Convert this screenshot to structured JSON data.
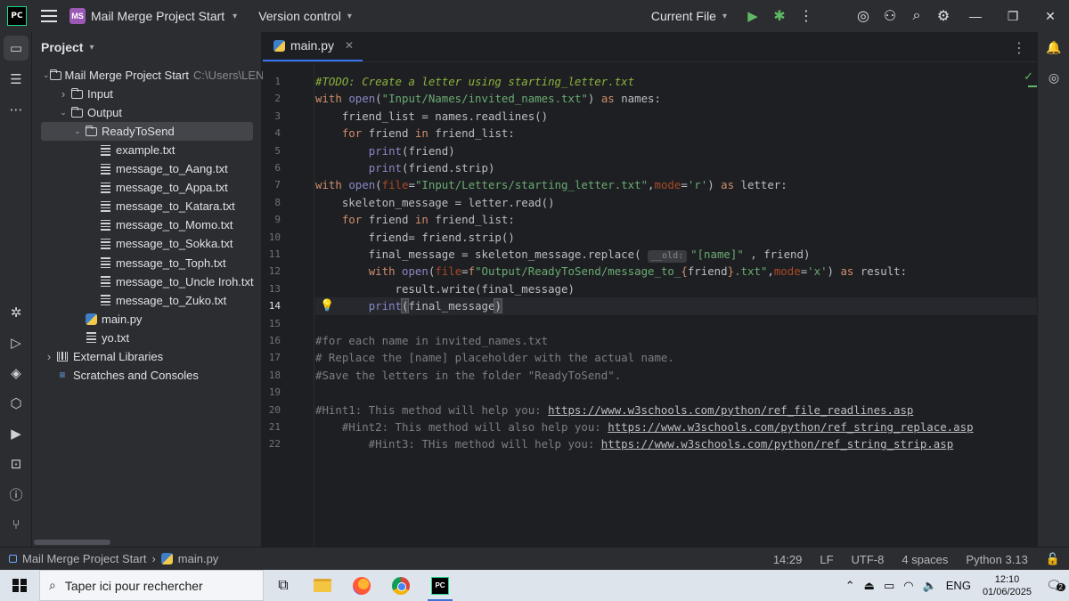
{
  "titlebar": {
    "logo_text": "PC",
    "project_badge": "MS",
    "project_name": "Mail Merge Project Start",
    "vcs_label": "Version control",
    "run_config": "Current File"
  },
  "project_panel": {
    "title": "Project",
    "tree": [
      {
        "label": "Mail Merge Project Start",
        "hint": "C:\\Users\\LEN",
        "type": "folder",
        "indent": 0,
        "arrow": "down"
      },
      {
        "label": "Input",
        "type": "folder",
        "indent": 1,
        "arrow": "right"
      },
      {
        "label": "Output",
        "type": "folder",
        "indent": 1,
        "arrow": "down"
      },
      {
        "label": "ReadyToSend",
        "type": "folder",
        "indent": 2,
        "arrow": "down",
        "selected": true
      },
      {
        "label": "example.txt",
        "type": "txt",
        "indent": 3
      },
      {
        "label": "message_to_Aang.txt",
        "type": "txt",
        "indent": 3
      },
      {
        "label": "message_to_Appa.txt",
        "type": "txt",
        "indent": 3
      },
      {
        "label": "message_to_Katara.txt",
        "type": "txt",
        "indent": 3
      },
      {
        "label": "message_to_Momo.txt",
        "type": "txt",
        "indent": 3
      },
      {
        "label": "message_to_Sokka.txt",
        "type": "txt",
        "indent": 3
      },
      {
        "label": "message_to_Toph.txt",
        "type": "txt",
        "indent": 3
      },
      {
        "label": "message_to_Uncle Iroh.txt",
        "type": "txt",
        "indent": 3
      },
      {
        "label": "message_to_Zuko.txt",
        "type": "txt",
        "indent": 3
      },
      {
        "label": "main.py",
        "type": "py",
        "indent": 2
      },
      {
        "label": "yo.txt",
        "type": "txt",
        "indent": 2
      },
      {
        "label": "External Libraries",
        "type": "lib",
        "indent": 0,
        "arrow": "right"
      },
      {
        "label": "Scratches and Consoles",
        "type": "scratch",
        "indent": 0
      }
    ]
  },
  "editor": {
    "tab_label": "main.py",
    "current_line": 14,
    "param_hint": "__old:",
    "lines": [
      [
        [
          "todo",
          "#TODO: Create a letter using starting_letter.txt"
        ]
      ],
      [
        [
          "kw",
          "with "
        ],
        [
          "bi",
          "open"
        ],
        [
          "bc",
          "("
        ],
        [
          "str",
          "\"Input/Names/invited_names.txt\""
        ],
        [
          "bc",
          ") "
        ],
        [
          "kw",
          "as"
        ],
        [
          "bc",
          " names:"
        ]
      ],
      [
        [
          "bc",
          "    friend_list = names.readlines()"
        ]
      ],
      [
        [
          "bc",
          "    "
        ],
        [
          "kw",
          "for"
        ],
        [
          "bc",
          " friend "
        ],
        [
          "kw",
          "in"
        ],
        [
          "bc",
          " friend_list:"
        ]
      ],
      [
        [
          "bc",
          "        "
        ],
        [
          "bi",
          "print"
        ],
        [
          "bc",
          "(friend)"
        ]
      ],
      [
        [
          "bc",
          "        "
        ],
        [
          "bi",
          "print"
        ],
        [
          "bc",
          "(friend.strip)"
        ]
      ],
      [
        [
          "kw",
          "with "
        ],
        [
          "bi",
          "open"
        ],
        [
          "bc",
          "("
        ],
        [
          "prm",
          "file"
        ],
        [
          "bc",
          "="
        ],
        [
          "str",
          "\"Input/Letters/starting_letter.txt\""
        ],
        [
          "bc",
          ","
        ],
        [
          "prm",
          "mode"
        ],
        [
          "bc",
          "="
        ],
        [
          "str",
          "'r'"
        ],
        [
          "bc",
          ") "
        ],
        [
          "kw",
          "as"
        ],
        [
          "bc",
          " letter:"
        ]
      ],
      [
        [
          "bc",
          "    skeleton_message = letter.read()"
        ]
      ],
      [
        [
          "bc",
          "    "
        ],
        [
          "kw",
          "for"
        ],
        [
          "bc",
          " friend "
        ],
        [
          "kw",
          "in"
        ],
        [
          "bc",
          " friend_list:"
        ]
      ],
      [
        [
          "bc",
          "        friend= friend.strip()"
        ]
      ],
      [
        [
          "bc",
          "        final_message = skeleton_message.replace( "
        ],
        [
          "hint",
          "__old:"
        ],
        [
          "str",
          "\"[name]\""
        ],
        [
          "bc",
          " , friend)"
        ]
      ],
      [
        [
          "bc",
          "        "
        ],
        [
          "kw",
          "with "
        ],
        [
          "bi",
          "open"
        ],
        [
          "bc",
          "("
        ],
        [
          "prm",
          "file"
        ],
        [
          "bc",
          "="
        ],
        [
          "kw",
          "f"
        ],
        [
          "str",
          "\"Output/ReadyToSend/message_to_"
        ],
        [
          "fmt",
          "{"
        ],
        [
          "bc",
          "friend"
        ],
        [
          "fmt",
          "}"
        ],
        [
          "str",
          ".txt\""
        ],
        [
          "bc",
          ","
        ],
        [
          "prm",
          "mode"
        ],
        [
          "bc",
          "="
        ],
        [
          "str",
          "'x'"
        ],
        [
          "bc",
          ") "
        ],
        [
          "kw",
          "as"
        ],
        [
          "bc",
          " result:"
        ]
      ],
      [
        [
          "bc",
          "            result.write(final_message)"
        ]
      ],
      [
        [
          "bc",
          "        "
        ],
        [
          "bi",
          "print"
        ],
        [
          "brkt",
          "("
        ],
        [
          "bc",
          "final_message"
        ],
        [
          "brkt",
          ")"
        ],
        [
          "caret",
          ""
        ]
      ],
      [],
      [
        [
          "cm",
          "#for each name in invited_names.txt"
        ]
      ],
      [
        [
          "cm",
          "# Replace the [name] placeholder with the actual name."
        ]
      ],
      [
        [
          "cm",
          "#Save the letters in the folder \"ReadyToSend\"."
        ]
      ],
      [],
      [
        [
          "cm",
          "#Hint1: This method will help you: "
        ],
        [
          "lnk",
          "https://www.w3schools.com/python/ref_file_readlines.asp"
        ]
      ],
      [
        [
          "cm",
          "    #Hint2: This method will also help you: "
        ],
        [
          "lnk",
          "https://www.w3schools.com/python/ref_string_replace.asp"
        ]
      ],
      [
        [
          "cm",
          "        #Hint3: THis method will help you: "
        ],
        [
          "lnk",
          "https://www.w3schools.com/python/ref_string_strip.asp"
        ]
      ]
    ]
  },
  "statusbar": {
    "breadcrumb_project": "Mail Merge Project Start",
    "breadcrumb_file": "main.py",
    "position": "14:29",
    "line_sep": "LF",
    "encoding": "UTF-8",
    "indent": "4 spaces",
    "interpreter": "Python 3.13"
  },
  "taskbar": {
    "search_placeholder": "Taper ici pour rechercher",
    "lang": "ENG",
    "time": "12:10",
    "date": "01/06/2025",
    "notif_count": "2"
  }
}
